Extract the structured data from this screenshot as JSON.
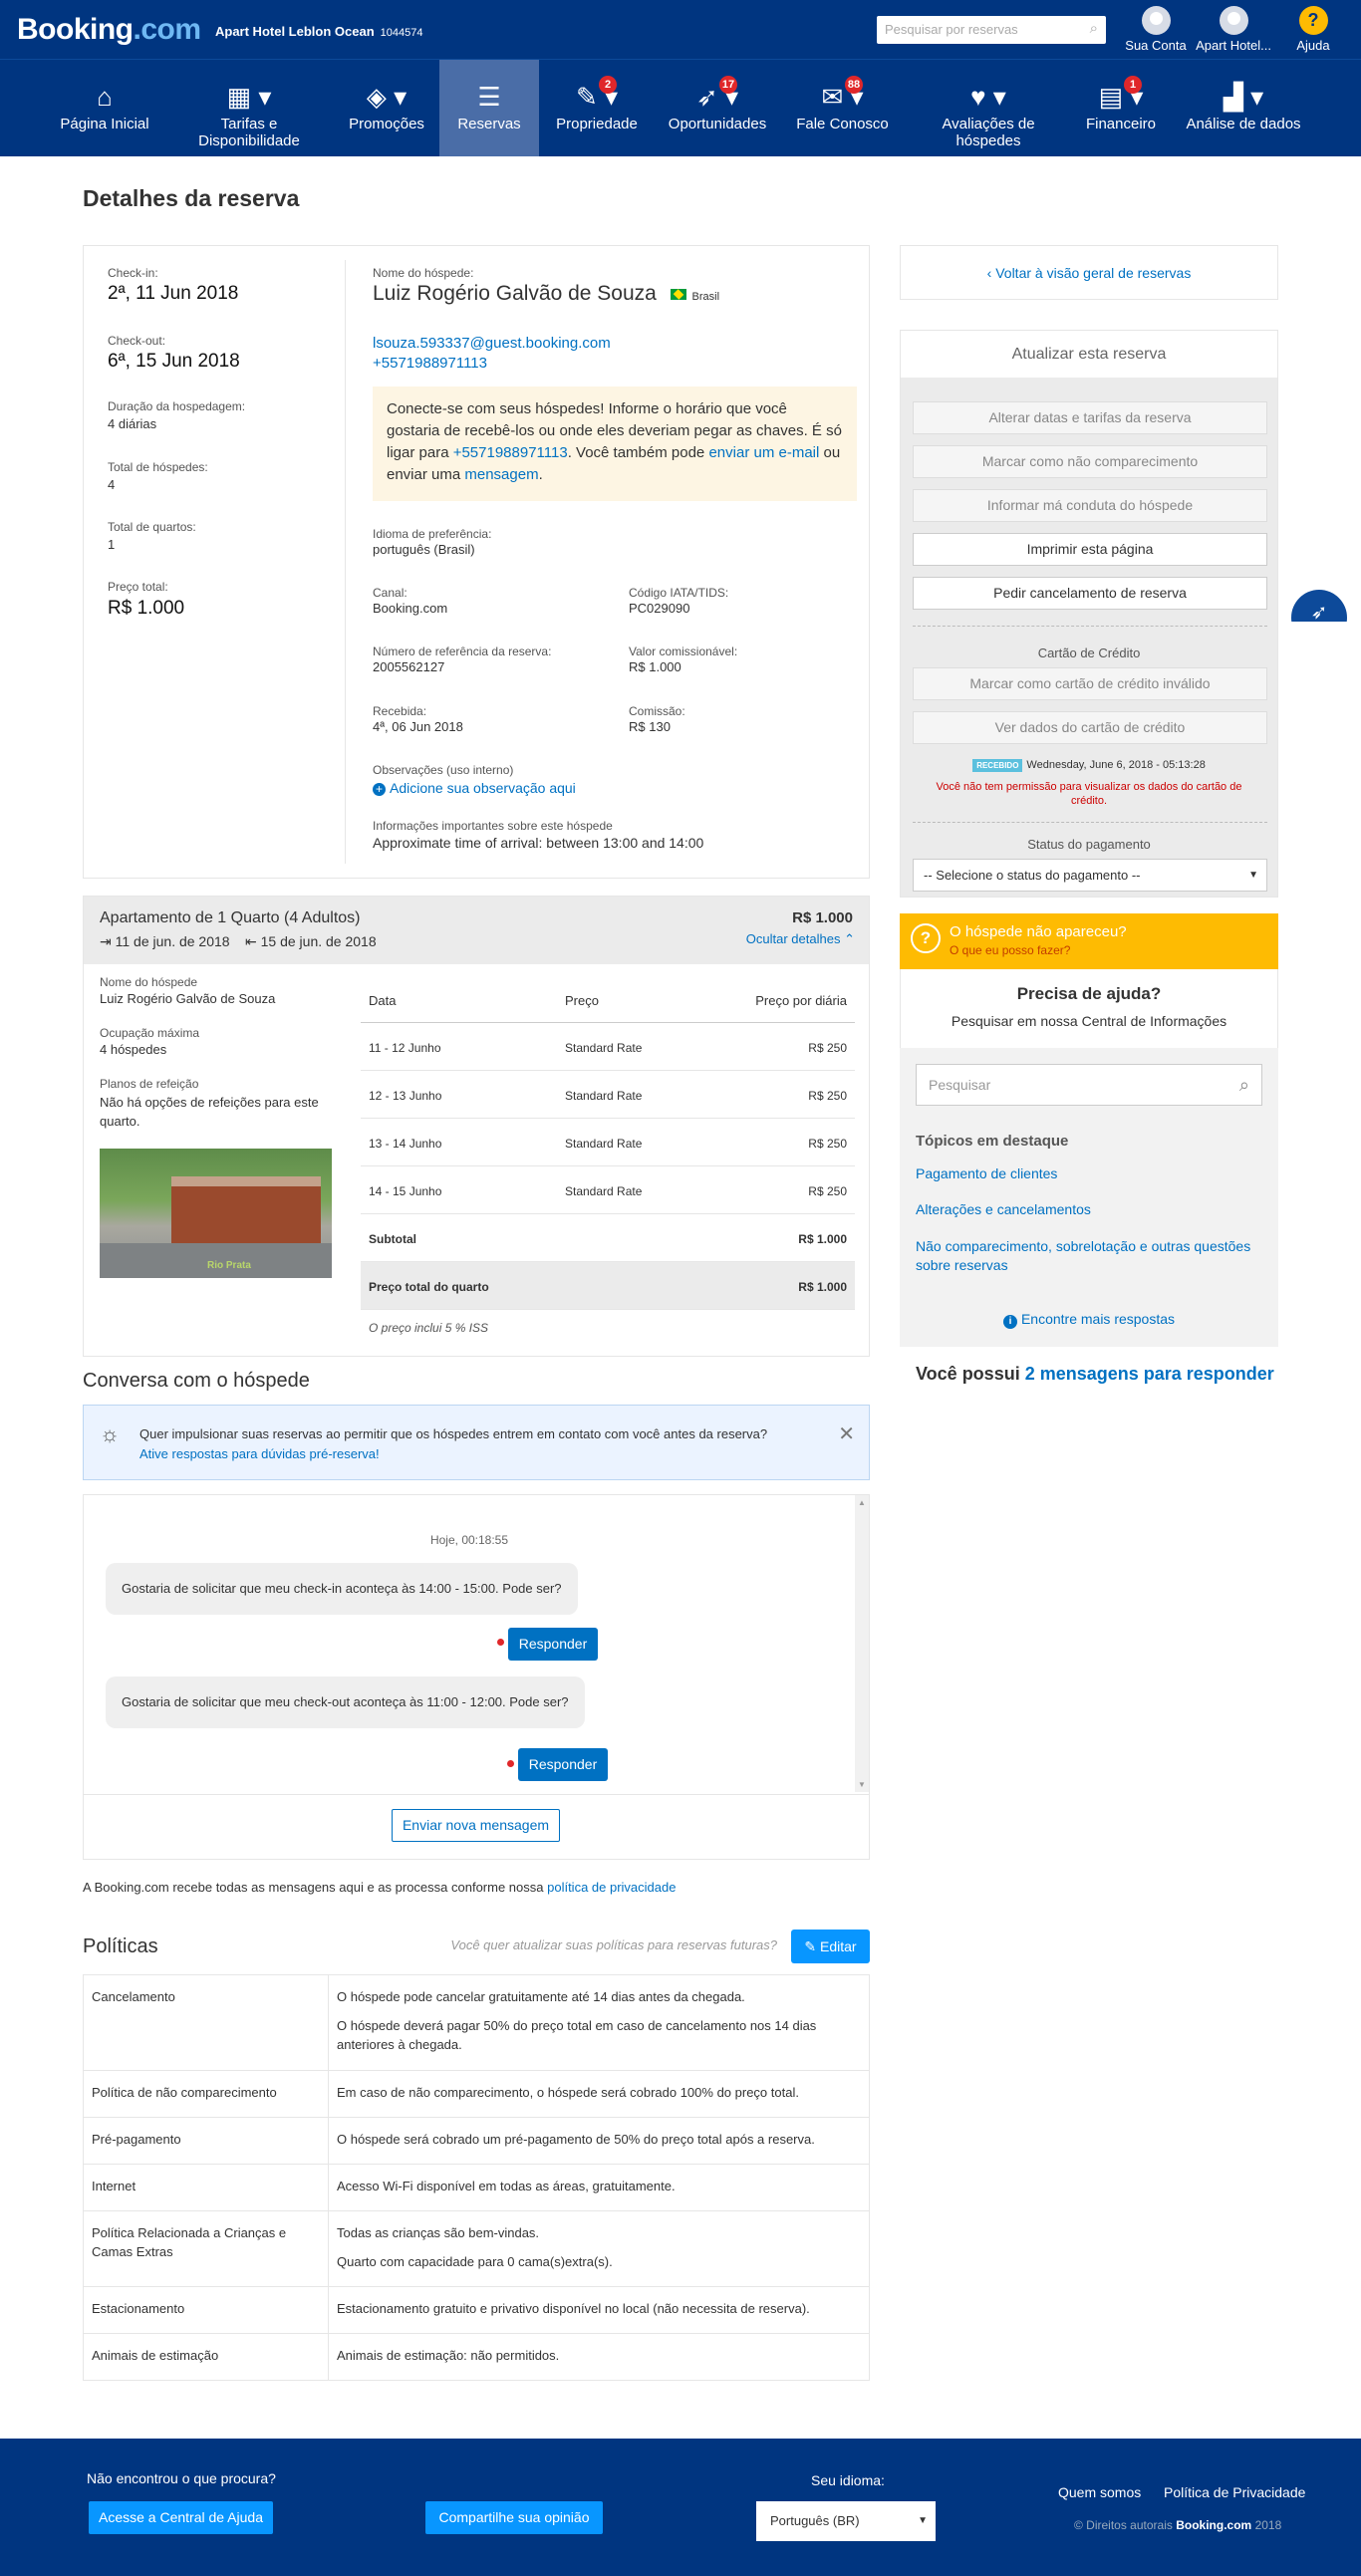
{
  "header": {
    "logo_main": "Booking",
    "logo_dot": ".com",
    "hotel_name": "Apart Hotel Leblon Ocean",
    "hotel_id": "1044574",
    "search_placeholder": "Pesquisar por reservas",
    "account_label": "Sua Conta",
    "hotel_label": "Apart Hotel...",
    "help_label": "Ajuda"
  },
  "nav": {
    "items": [
      {
        "label": "Página Inicial",
        "icon": "home-icon"
      },
      {
        "label": "Tarifas e Disponibilidade",
        "icon": "calendar-icon"
      },
      {
        "label": "Promoções",
        "icon": "tag-icon"
      },
      {
        "label": "Reservas",
        "icon": "list-icon"
      },
      {
        "label": "Propriedade",
        "icon": "pencil-icon",
        "badge": "2"
      },
      {
        "label": "Oportunidades",
        "icon": "rocket-icon",
        "badge": "17"
      },
      {
        "label": "Fale Conosco",
        "icon": "envelope-icon",
        "badge": "88"
      },
      {
        "label": "Avaliações de hóspedes",
        "icon": "heart-icon"
      },
      {
        "label": "Financeiro",
        "icon": "document-icon",
        "badge": "1"
      },
      {
        "label": "Análise de dados",
        "icon": "bar-chart-icon"
      }
    ]
  },
  "page_title": "Detalhes da reserva",
  "stay": {
    "checkin_label": "Check-in:",
    "checkin": "2ª, 11 Jun 2018",
    "checkout_label": "Check-out:",
    "checkout": "6ª, 15 Jun 2018",
    "duration_label": "Duração da hospedagem:",
    "duration": "4 diárias",
    "guests_label": "Total de hóspedes:",
    "guests": "4",
    "rooms_label": "Total de quartos:",
    "rooms": "1",
    "price_label": "Preço total:",
    "price": "R$ 1.000"
  },
  "guest": {
    "name_label": "Nome do hóspede:",
    "name": "Luiz Rogério Galvão de Souza",
    "country": "Brasil",
    "email": "lsouza.593337@guest.booking.com",
    "phone": "+5571988971113",
    "note_1": "Conecte-se com seus hóspedes! Informe o horário que você gostaria de recebê-los ou onde eles deveriam pegar as chaves. É só ligar para ",
    "note_phone": "+5571988971113",
    "note_2": ". Você também pode ",
    "note_email_link": "enviar um e-mail",
    "note_3": " ou enviar uma ",
    "note_msg_link": "mensagem",
    "note_4": ".",
    "lang_label": "Idioma de preferência:",
    "lang": "português (Brasil)",
    "channel_label": "Canal:",
    "channel": "Booking.com",
    "iata_label": "Código IATA/TIDS:",
    "iata": "PC029090",
    "ref_label": "Número de referência da reserva:",
    "ref": "2005562127",
    "commissionable_label": "Valor comissionável:",
    "commissionable": "R$ 1.000",
    "received_label": "Recebida:",
    "received": "4ª, 06 Jun 2018",
    "commission_label": "Comissão:",
    "commission": "R$ 130",
    "obs_label": "Observações (uso interno)",
    "obs_link": "Adicione sua observação aqui",
    "info_label": "Informações importantes sobre este hóspede",
    "info": "Approximate time of arrival: between 13:00 and 14:00"
  },
  "room": {
    "title": "Apartamento de 1 Quarto (4 Adultos)",
    "price": "R$ 1.000",
    "checkin": "11 de jun. de 2018",
    "checkout": "15 de jun. de 2018",
    "hide_details": "Ocultar detalhes",
    "guest_label": "Nome do hóspede",
    "guest": "Luiz Rogério Galvão de Souza",
    "occupancy_label": "Ocupação máxima",
    "occupancy": "4 hóspedes",
    "meal_label": "Planos de refeição",
    "meal": "Não há opções de refeições para este quarto.",
    "photo_caption": "Rio Prata",
    "table_headers": [
      "Data",
      "Preço",
      "Preço por diária"
    ],
    "rows": [
      {
        "date": "11 - 12 Junho",
        "rate": "Standard Rate",
        "price": "R$ 250"
      },
      {
        "date": "12 - 13 Junho",
        "rate": "Standard Rate",
        "price": "R$ 250"
      },
      {
        "date": "13 - 14 Junho",
        "rate": "Standard Rate",
        "price": "R$ 250"
      },
      {
        "date": "14 - 15 Junho",
        "rate": "Standard Rate",
        "price": "R$ 250"
      }
    ],
    "subtotal_label": "Subtotal",
    "subtotal": "R$ 1.000",
    "total_label": "Preço total do quarto",
    "total": "R$ 1.000",
    "tax_note": "O preço inclui 5 % ISS"
  },
  "conversation": {
    "title": "Conversa com o hóspede",
    "banner_text": "Quer impulsionar suas reservas ao permitir que os hóspedes entrem em contato com você antes da reserva?",
    "banner_link": "Ative respostas para dúvidas pré-reserva!",
    "timestamp": "Hoje, 00:18:55",
    "msg1": "Gostaria de solicitar que meu check-in aconteça às 14:00 - 15:00. Pode ser?",
    "msg2": "Gostaria de solicitar que meu check-out aconteça às 11:00 - 12:00. Pode ser?",
    "reply": "Responder",
    "new_message": "Enviar nova mensagem",
    "privacy_text": "A Booking.com recebe todas as mensagens aqui e as processa conforme nossa ",
    "privacy_link": "política de privacidade"
  },
  "policies": {
    "title": "Políticas",
    "prompt": "Você quer atualizar suas políticas para reservas futuras?",
    "edit": "Editar",
    "rows": [
      {
        "k": "Cancelamento",
        "v": "O hóspede pode cancelar gratuitamente até 14 dias antes da chegada.",
        "v2": "O hóspede deverá pagar 50% do preço total em caso de cancelamento nos 14 dias anteriores à chegada."
      },
      {
        "k": "Política de não comparecimento",
        "v": "Em caso de não comparecimento, o hóspede será cobrado 100% do preço total."
      },
      {
        "k": "Pré-pagamento",
        "v": "O hóspede será cobrado um pré-pagamento de 50% do preço total após a reserva."
      },
      {
        "k": "Internet",
        "v": "Acesso Wi-Fi disponível em todas as áreas, gratuitamente."
      },
      {
        "k": "Política Relacionada a Crianças e Camas Extras",
        "v": "Todas as crianças são bem-vindas.",
        "v2": "Quarto com capacidade para 0 cama(s)extra(s)."
      },
      {
        "k": "Estacionamento",
        "v": "Estacionamento gratuito e privativo disponível no local (não necessita de reserva)."
      },
      {
        "k": "Animais de estimação",
        "v": "Animais de estimação: não permitidos."
      }
    ]
  },
  "sidebar": {
    "back": "Voltar à visão geral de reservas",
    "update_title": "Atualizar esta reserva",
    "btn_change": "Alterar datas e tarifas da reserva",
    "btn_noshow": "Marcar como não comparecimento",
    "btn_misconduct": "Informar má conduta do hóspede",
    "btn_print": "Imprimir esta página",
    "btn_cancel": "Pedir cancelamento de reserva",
    "card_title": "Cartão de Crédito",
    "btn_invalid_card": "Marcar como cartão de crédito inválido",
    "btn_view_card": "Ver dados do cartão de crédito",
    "received_badge": "RECEBIDO",
    "received_date": "Wednesday, June 6, 2018 - 05:13:28",
    "no_permission": "Você não tem permissão para visualizar os dados do cartão de crédito.",
    "payment_status_label": "Status do pagamento",
    "payment_status_placeholder": "-- Selecione o status do pagamento --",
    "noshow_title": "O hóspede não apareceu?",
    "noshow_link": "O que eu posso fazer?",
    "help_title": "Precisa de ajuda?",
    "help_sub": "Pesquisar em nossa Central de Informações",
    "help_search": "Pesquisar",
    "topics_title": "Tópicos em destaque",
    "topic1": "Pagamento de clientes",
    "topic2": "Alterações e cancelamentos",
    "topic3": "Não comparecimento, sobrelotação e outras questões sobre reservas",
    "more_answers": "Encontre mais respostas",
    "messages_prefix": "Você possui ",
    "messages_link": "2 mensagens para responder"
  },
  "footer": {
    "not_found": "Não encontrou o que procura?",
    "help_center": "Acesse a Central de Ajuda",
    "share": "Compartilhe sua opinião",
    "lang_label": "Seu idioma:",
    "lang_value": "Português (BR)",
    "about": "Quem somos",
    "privacy": "Política de Privacidade",
    "copyright_prefix": "© Direitos autorais ",
    "copyright_brand": "Booking.com",
    "copyright_year": " 2018"
  },
  "colors": {
    "brand": "#003580",
    "link": "#0071c2",
    "accent": "#febb02",
    "alert": "#e0272a"
  }
}
